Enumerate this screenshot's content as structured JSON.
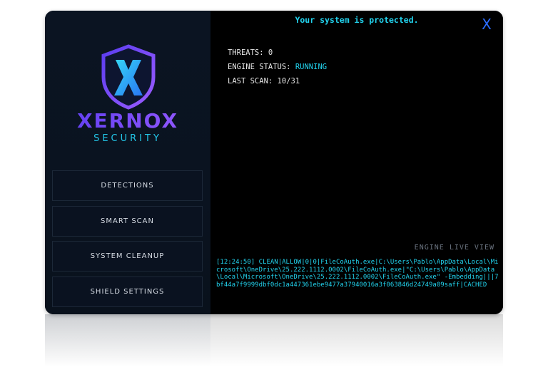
{
  "brand": {
    "name": "XERNOX",
    "subtitle": "SECURITY"
  },
  "nav": {
    "items": [
      {
        "label": "DETECTIONS"
      },
      {
        "label": "SMART SCAN"
      },
      {
        "label": "SYSTEM CLEANUP"
      },
      {
        "label": "SHIELD SETTINGS"
      }
    ]
  },
  "header": {
    "banner": "Your system is protected.",
    "close_label": "X"
  },
  "status": {
    "threats_label": "THREATS:",
    "threats_value": "0",
    "engine_label": "ENGINE STATUS:",
    "engine_value": "RUNNING",
    "scan_label": "LAST SCAN:",
    "scan_value": "10/31"
  },
  "live_view": {
    "label": "ENGINE LIVE VIEW",
    "log": "[12:24:50] CLEAN|ALLOW|0|0|FileCoAuth.exe|C:\\Users\\Pablo\\AppData\\Local\\Microsoft\\OneDrive\\25.222.1112.0002\\FileCoAuth.exe|\"C:\\Users\\Pablo\\AppData\\Local\\Microsoft\\OneDrive\\25.222.1112.0002\\FileCoAuth.exe\" -Embedding|||7bf44a7f9999dbf0dc1a447361ebe9477a37940016a3f063846d24749a09saff|CACHED"
  },
  "colors": {
    "accent_cyan": "#22d3ee",
    "brand_purple": "#7a4dff",
    "close_blue": "#2b6cff"
  }
}
